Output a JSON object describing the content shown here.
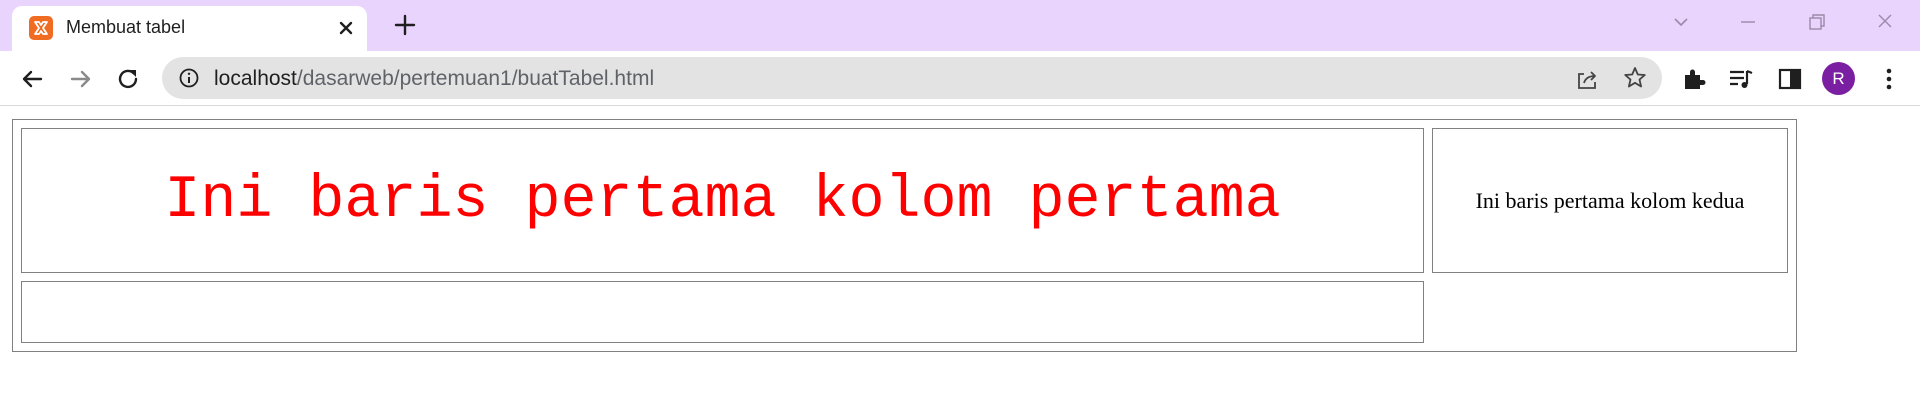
{
  "browser": {
    "tab": {
      "title": "Membuat tabel",
      "favicon": "xampp-icon"
    },
    "url": {
      "host": "localhost",
      "path": "/dasarweb/pertemuan1/buatTabel.html"
    },
    "profile_initial": "R",
    "colors": {
      "tabstrip": "#e8d4fd",
      "omnibox": "#e3e3e3",
      "avatar": "#7b1fa2",
      "favicon": "#ef6c22"
    }
  },
  "page": {
    "table": {
      "row1_col1": "Ini baris pertama kolom pertama",
      "row1_col2": "Ini baris pertama kolom kedua",
      "row2_col1": ""
    },
    "colors": {
      "big_text": "#ff0000"
    }
  }
}
